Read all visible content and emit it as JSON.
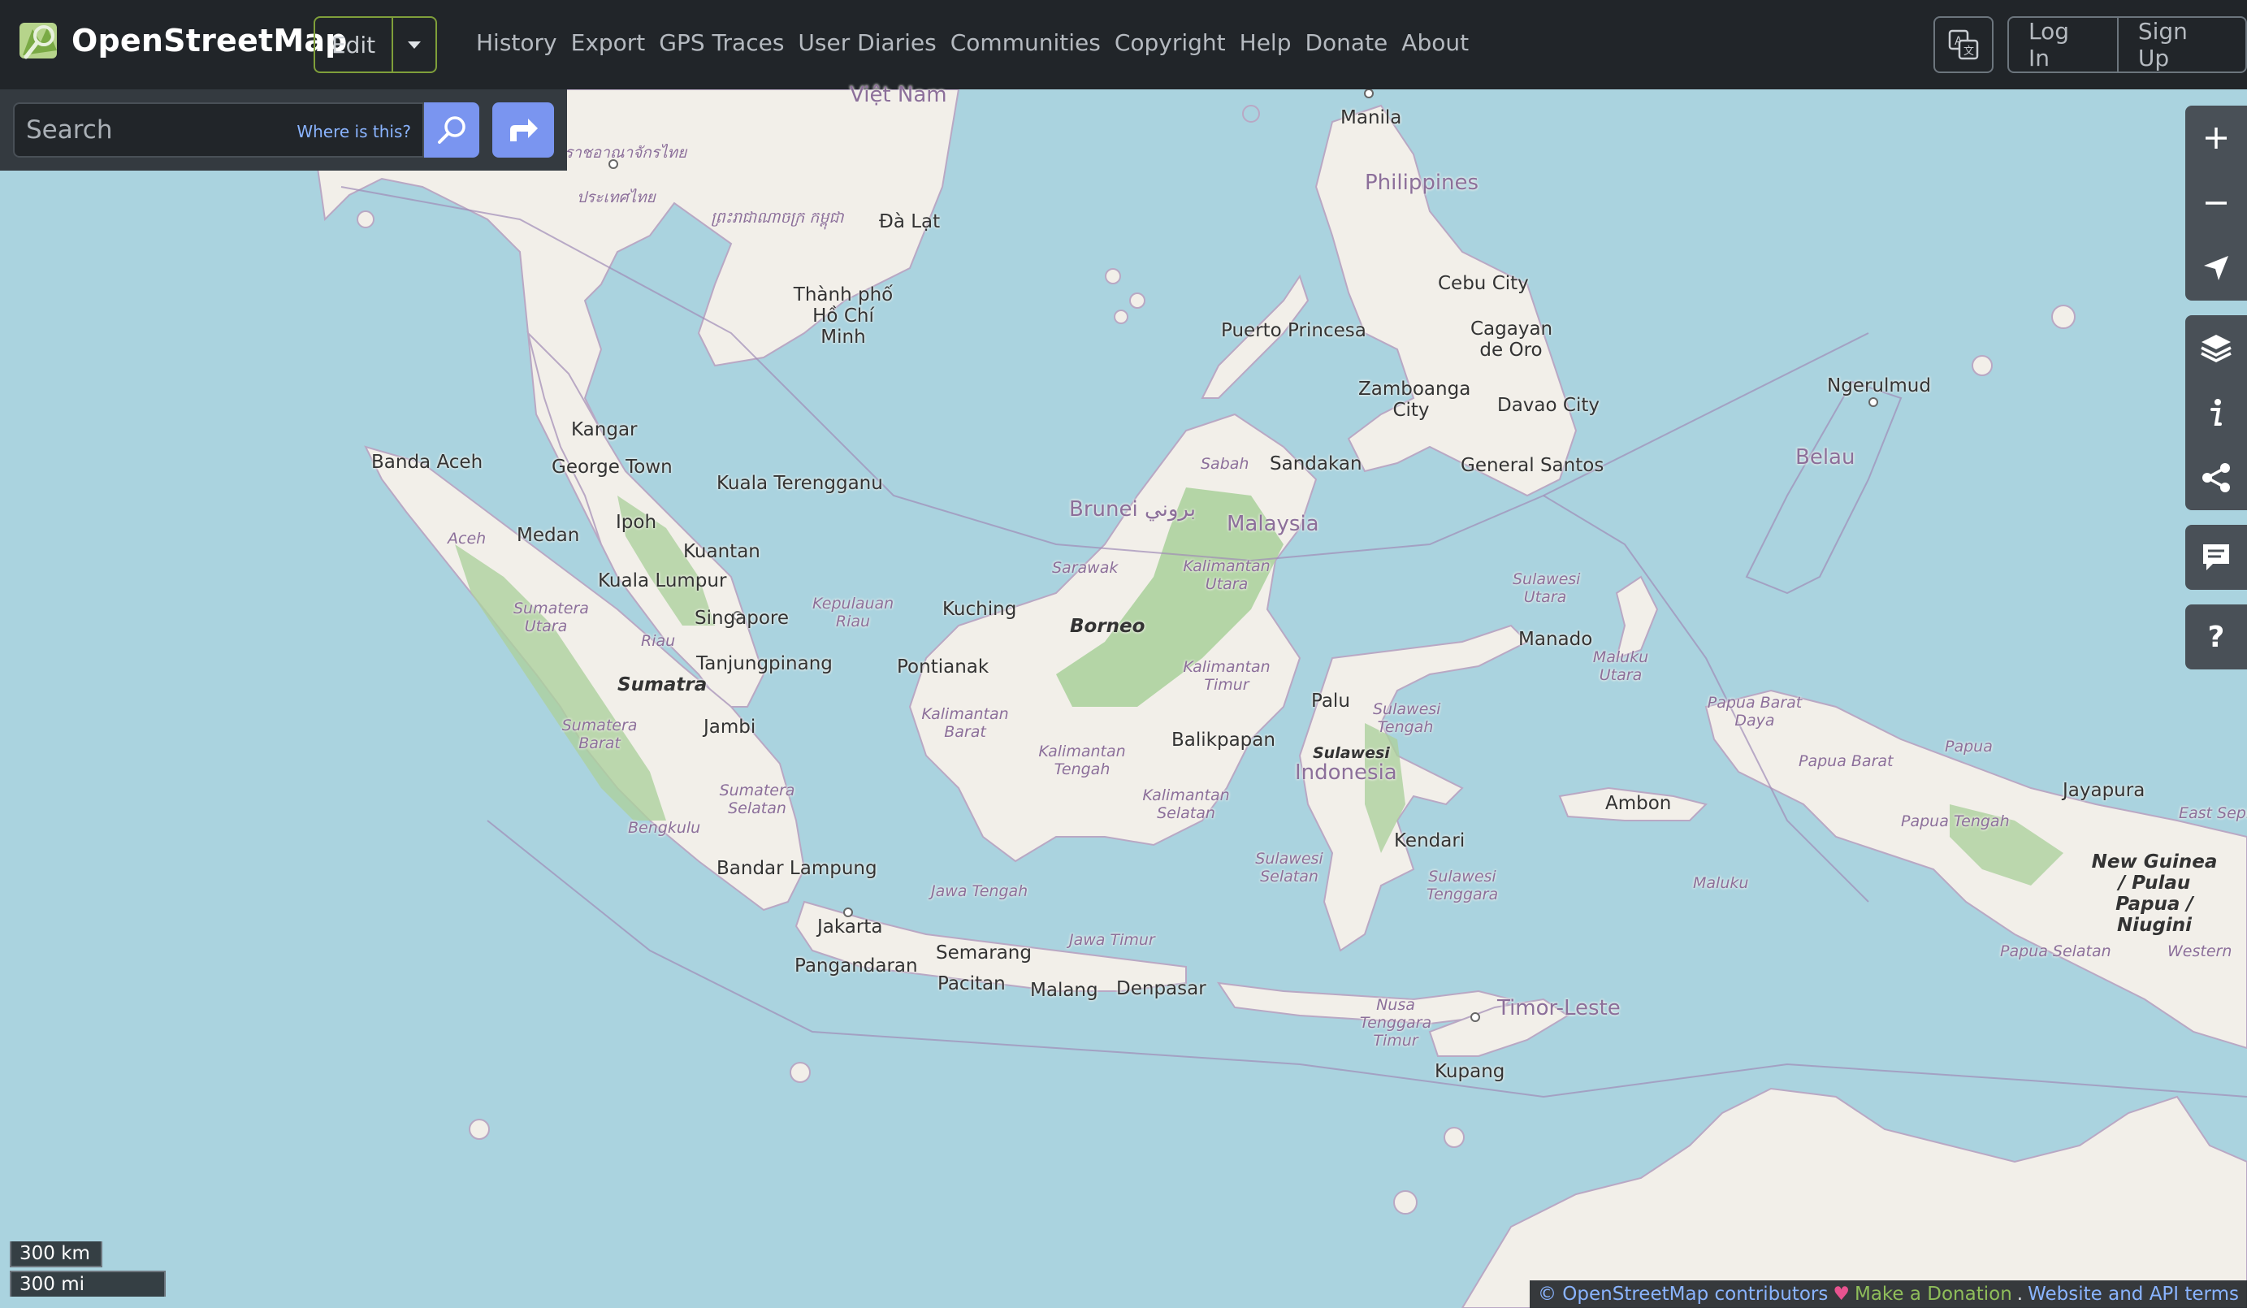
{
  "header": {
    "brand": "OpenStreetMap",
    "edit_label": "Edit",
    "nav": [
      "History",
      "Export",
      "GPS Traces",
      "User Diaries",
      "Communities",
      "Copyright",
      "Help",
      "Donate",
      "About"
    ],
    "login": "Log In",
    "signup": "Sign Up"
  },
  "search": {
    "placeholder": "Search",
    "where_link": "Where is this?"
  },
  "map": {
    "labels": {
      "vietnam": "Việt Nam",
      "thailand_th": "ราชอาณาจักรไทย",
      "thailand_kh": "ประเทศไทย",
      "cambodia": "ព្រះរាជាណាចក្រ កម្ពុជា",
      "dalat": "Đà Lạt",
      "hcm": "Thành phố Hồ Chí Minh",
      "manila": "Manila",
      "philippines": "Philippines",
      "cebu": "Cebu City",
      "cagayan": "Cagayan de Oro",
      "puerto_princesa": "Puerto Princesa",
      "zamboanga": "Zamboanga City",
      "davao": "Davao City",
      "ngerulmud": "Ngerulmud",
      "belau": "Belau",
      "general_santos": "General Santos",
      "sabah": "Sabah",
      "sandakan": "Sandakan",
      "brunei": "Brunei بروني",
      "malaysia": "Malaysia",
      "kangar": "Kangar",
      "banda_aceh": "Banda Aceh",
      "george_town": "George Town",
      "kuala_terengganu": "Kuala Terengganu",
      "ipoh": "Ipoh",
      "kuantan": "Kuantan",
      "kuala_lumpur": "Kuala Lumpur",
      "medan": "Medan",
      "aceh": "Aceh",
      "sumatera_utara": "Sumatera Utara",
      "singapore": "Singapore",
      "riau": "Riau",
      "kepulauan_riau": "Kepulauan Riau",
      "tanjungpinang": "Tanjungpinang",
      "kuching": "Kuching",
      "sarawak": "Sarawak",
      "borneo": "Borneo",
      "kalimantan_utara": "Kalimantan Utara",
      "kalimantan_timur": "Kalimantan Timur",
      "pontianak": "Pontianak",
      "kalimantan_barat": "Kalimantan Barat",
      "kalimantan_tengah": "Kalimantan Tengah",
      "kalimantan_selatan": "Kalimantan Selatan",
      "balikpapan": "Balikpapan",
      "sumatra": "Sumatra",
      "jambi": "Jambi",
      "sumatera_barat": "Sumatera Barat",
      "sumatera_selatan": "Sumatera Selatan",
      "bengkulu": "Bengkulu",
      "bandar_lampung": "Bandar Lampung",
      "sulawesi_utara": "Sulawesi Utara",
      "manado": "Manado",
      "palu": "Palu",
      "sulawesi_tengah": "Sulawesi Tengah",
      "sulawesi": "Sulawesi",
      "indonesia": "Indonesia",
      "maluku_utara": "Maluku Utara",
      "papua_barat_daya": "Papua Barat Daya",
      "papua_barat": "Papua Barat",
      "papua": "Papua",
      "jayapura": "Jayapura",
      "papua_tengah": "Papua Tengah",
      "east_sepik": "East Sepik",
      "new_guinea": "New Guinea / Pulau Papua / Niugini",
      "ambon": "Ambon",
      "kendari": "Kendari",
      "sulawesi_selatan": "Sulawesi Selatan",
      "sulawesi_tenggara": "Sulawesi Tenggara",
      "maluku": "Maluku",
      "papua_selatan": "Papua Selatan",
      "western": "Western",
      "jawa_tengah": "Jawa Tengah",
      "jakarta": "Jakarta",
      "pangandaran": "Pangandaran",
      "semarang": "Semarang",
      "jawa_timur": "Jawa Timur",
      "pacitan": "Pacitan",
      "malang": "Malang",
      "denpasar": "Denpasar",
      "ntt": "Nusa Tenggara Timur",
      "timor_leste": "Timor-Leste",
      "kupang": "Kupang"
    },
    "scale_km": "300 km",
    "scale_mi": "300 mi"
  },
  "attribution": {
    "contributors": "© OpenStreetMap contributors",
    "donate": "Make a Donation",
    "terms": "Website and API terms"
  },
  "colors": {
    "header_bg": "#212529",
    "sea": "#aad3df",
    "land": "#f2efe9",
    "forest": "#add19e",
    "accent": "#7a95f0"
  }
}
